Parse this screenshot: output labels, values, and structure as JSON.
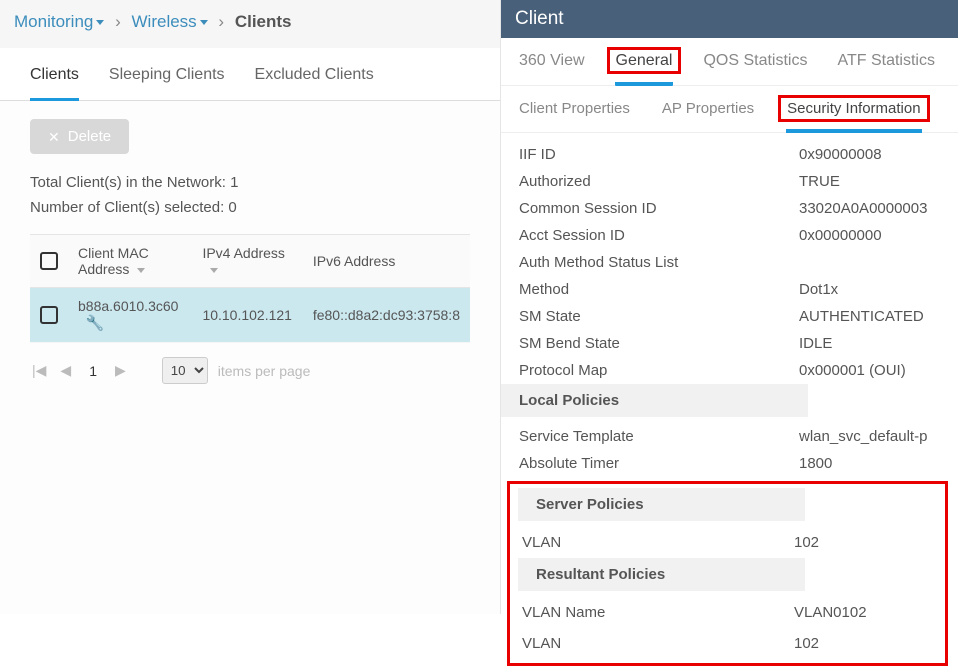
{
  "breadcrumb": {
    "part1": "Monitoring",
    "part2": "Wireless",
    "current": "Clients"
  },
  "left_tabs": {
    "clients": "Clients",
    "sleeping": "Sleeping Clients",
    "excluded": "Excluded Clients"
  },
  "toolbar": {
    "delete_label": "Delete"
  },
  "stats": {
    "total_label": "Total Client(s) in the Network:",
    "total_value": "1",
    "selected_label": "Number of Client(s) selected:",
    "selected_value": "0"
  },
  "columns": {
    "mac": "Client MAC Address",
    "ipv4": "IPv4 Address",
    "ipv6": "IPv6 Address"
  },
  "rows": [
    {
      "mac": "b88a.6010.3c60",
      "ipv4": "10.10.102.121",
      "ipv6": "fe80::d8a2:dc93:3758:8"
    }
  ],
  "pager": {
    "current": "1",
    "per_page": "10",
    "per_page_label": "items per page"
  },
  "panel_title": "Client",
  "tabs_row1": {
    "t360": "360 View",
    "general": "General",
    "qos": "QOS Statistics",
    "atf": "ATF Statistics"
  },
  "tabs_row2": {
    "client_props": "Client Properties",
    "ap_props": "AP Properties",
    "sec_info": "Security Information"
  },
  "kv": [
    {
      "k": "IIF ID",
      "v": "0x90000008"
    },
    {
      "k": "Authorized",
      "v": "TRUE"
    },
    {
      "k": "Common Session ID",
      "v": "33020A0A0000003"
    },
    {
      "k": "Acct Session ID",
      "v": "0x00000000"
    },
    {
      "k": "Auth Method Status List",
      "v": ""
    },
    {
      "k": "Method",
      "v": "Dot1x"
    },
    {
      "k": "SM State",
      "v": "AUTHENTICATED"
    },
    {
      "k": "SM Bend State",
      "v": "IDLE"
    },
    {
      "k": "Protocol Map",
      "v": "0x000001 (OUI)"
    }
  ],
  "sections": {
    "local": "Local Policies",
    "server": "Server Policies",
    "resultant": "Resultant Policies"
  },
  "local_kv": [
    {
      "k": "Service Template",
      "v": "wlan_svc_default-p"
    },
    {
      "k": "Absolute Timer",
      "v": "1800"
    }
  ],
  "server_kv": [
    {
      "k": "VLAN",
      "v": "102"
    }
  ],
  "resultant_kv": [
    {
      "k": "VLAN Name",
      "v": "VLAN0102"
    },
    {
      "k": "VLAN",
      "v": "102"
    }
  ]
}
